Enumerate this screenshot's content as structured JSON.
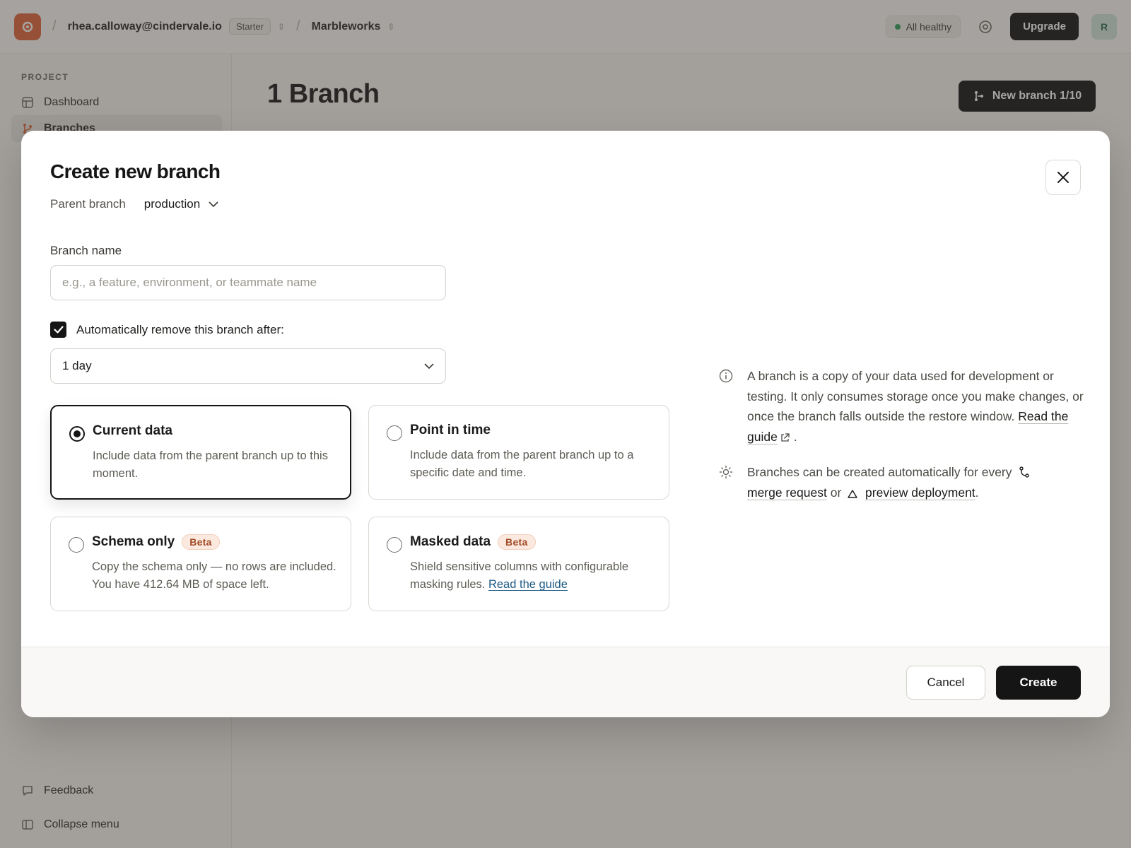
{
  "topbar": {
    "account_email": "rhea.calloway@cindervale.io",
    "plan_badge": "Starter",
    "project_name": "Marbleworks",
    "status_text": "All healthy",
    "upgrade_label": "Upgrade",
    "avatar_initial": "R",
    "colors": {
      "logo": "#e0643b",
      "status_ok": "#2f9e5b"
    }
  },
  "sidebar": {
    "section_label": "PROJECT",
    "items": [
      {
        "label": "Dashboard",
        "icon": "grid-icon"
      },
      {
        "label": "Branches",
        "icon": "branch-icon",
        "active": true
      }
    ],
    "bottom_items": [
      {
        "label": "Feedback",
        "icon": "chat-icon"
      },
      {
        "label": "Collapse menu",
        "icon": "panel-icon"
      }
    ]
  },
  "main": {
    "title": "1 Branch",
    "new_branch_label": "New branch 1/10"
  },
  "modal": {
    "title": "Create new branch",
    "parent_label": "Parent branch",
    "parent_value": "production",
    "name_label": "Branch name",
    "name_value": "",
    "name_placeholder": "e.g., a feature, environment, or teammate name",
    "auto_remove_label": "Automatically remove this branch after:",
    "auto_remove_checked": true,
    "duration_value": "1 day",
    "options": [
      {
        "title": "Current data",
        "desc": "Include data from the parent branch up to this moment.",
        "selected": true
      },
      {
        "title": "Point in time",
        "desc": "Include data from the parent branch up to a specific date and time.",
        "selected": false
      },
      {
        "title": "Schema only",
        "badge": "Beta",
        "desc": "Copy the schema only — no rows are included. You have 412.64 MB of space left.",
        "selected": false
      },
      {
        "title": "Masked data",
        "badge": "Beta",
        "desc": "Shield sensitive columns with configurable masking rules.",
        "link": "Read the guide",
        "selected": false
      }
    ],
    "info": {
      "p1_text": "A branch is a copy of your data used for development or testing. It only consumes storage once you make changes, or once the branch falls outside the restore window.",
      "p1_link": "Read the guide",
      "p2_text": "Branches can be created automatically for every",
      "p2_link1": "merge request",
      "p2_or": "or",
      "p2_link2": "preview deployment"
    },
    "cancel_label": "Cancel",
    "create_label": "Create"
  }
}
